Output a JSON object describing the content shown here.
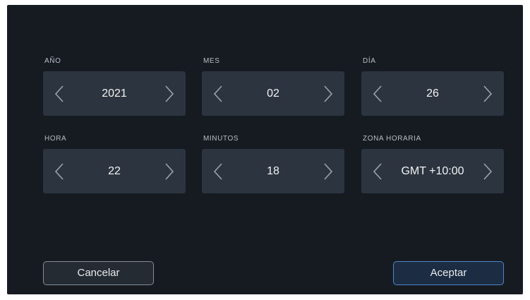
{
  "fields": [
    {
      "label": "AÑO",
      "value": "2021"
    },
    {
      "label": "MES",
      "value": "02"
    },
    {
      "label": "DÍA",
      "value": "26"
    },
    {
      "label": "HORA",
      "value": "22"
    },
    {
      "label": "MINUTOS",
      "value": "18"
    },
    {
      "label": "ZONA HORARIA",
      "value": "GMT +10:00"
    }
  ],
  "buttons": {
    "cancel_label": "Cancelar",
    "accept_label": "Aceptar"
  },
  "icons": {
    "decrement": "chevron-left-icon",
    "increment": "chevron-right-icon"
  },
  "colors": {
    "background": "#161b22",
    "stepper": "#2c3440",
    "accent": "#4f86c9",
    "text": "#f1f3f5",
    "label": "#b6bec8"
  }
}
